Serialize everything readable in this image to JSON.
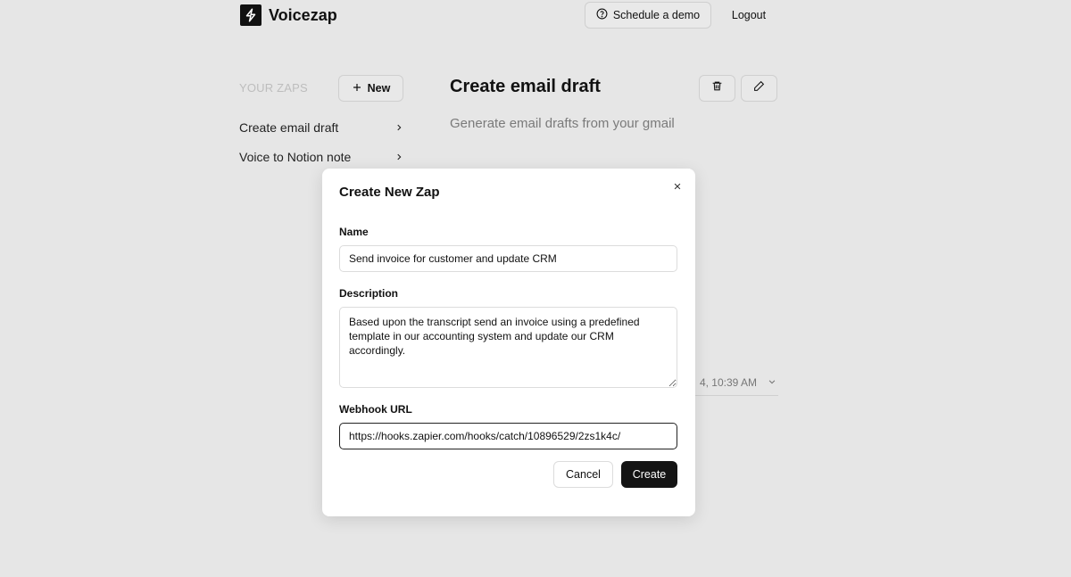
{
  "header": {
    "app_name": "Voicezap",
    "logo_icon": "lightning-bolt-icon",
    "schedule_demo_label": "Schedule a demo",
    "logout_label": "Logout"
  },
  "sidebar": {
    "title": "YOUR ZAPS",
    "new_button_label": "New",
    "items": [
      {
        "label": "Create email draft"
      },
      {
        "label": "Voice to Notion note"
      }
    ]
  },
  "main": {
    "title": "Create email draft",
    "subtitle": "Generate email drafts from your gmail",
    "run_time_partial": "4, 10:39 AM"
  },
  "modal": {
    "title": "Create New Zap",
    "name_label": "Name",
    "name_value": "Send invoice for customer and update CRM",
    "description_label": "Description",
    "description_value": "Based upon the transcript send an invoice using a predefined template in our accounting system and update our CRM accordingly.",
    "webhook_label": "Webhook URL",
    "webhook_value": "https://hooks.zapier.com/hooks/catch/10896529/2zs1k4c/",
    "cancel_label": "Cancel",
    "create_label": "Create"
  },
  "colors": {
    "background": "#e6e6e6",
    "primary": "#141414",
    "muted_text": "#7a7a7a"
  }
}
